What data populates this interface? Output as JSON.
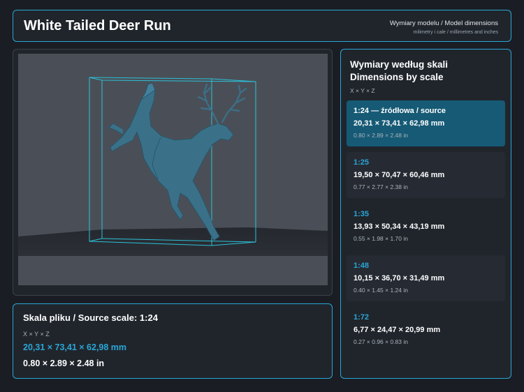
{
  "header": {
    "title": "White Tailed Deer Run",
    "subtitle": "Wymiary modelu / Model dimensions",
    "units_note": "milimetry i cale / millimetres and inches"
  },
  "source_panel": {
    "heading": "Skala pliku / Source scale: 1:24",
    "axes": "X × Y × Z",
    "mm": "20,31 × 73,41 × 62,98 mm",
    "inches": "0.80 × 2.89 × 2.48 in"
  },
  "scales_panel": {
    "heading_line1": "Wymiary według skali",
    "heading_line2": "Dimensions by scale",
    "axes": "X × Y × Z",
    "items": [
      {
        "label": "1:24  —  źródłowa / source",
        "mm": "20,31 × 73,41 × 62,98 mm",
        "inches": "0.80 × 2.89 × 2.48 in",
        "selected": true
      },
      {
        "label": "1:25",
        "mm": "19,50 × 70,47 × 60,46 mm",
        "inches": "0.77 × 2.77 × 2.38 in"
      },
      {
        "label": "1:35",
        "mm": "13,93 × 50,34 × 43,19 mm",
        "inches": "0.55 × 1.98 × 1.70 in"
      },
      {
        "label": "1:48",
        "mm": "10,15 × 36,70 × 31,49 mm",
        "inches": "0.40 × 1.45 × 1.24 in"
      },
      {
        "label": "1:72",
        "mm": "6,77 × 24,47 × 20,99 mm",
        "inches": "0.27 × 0.96 × 0.83 in"
      }
    ]
  },
  "viewer": {
    "model_icon": "deer-model-render",
    "box_icon": "bounding-box"
  },
  "colors": {
    "accent": "#2aa6d6",
    "background": "#1a1e24",
    "panel": "#20252c",
    "selected": "#165a75"
  }
}
